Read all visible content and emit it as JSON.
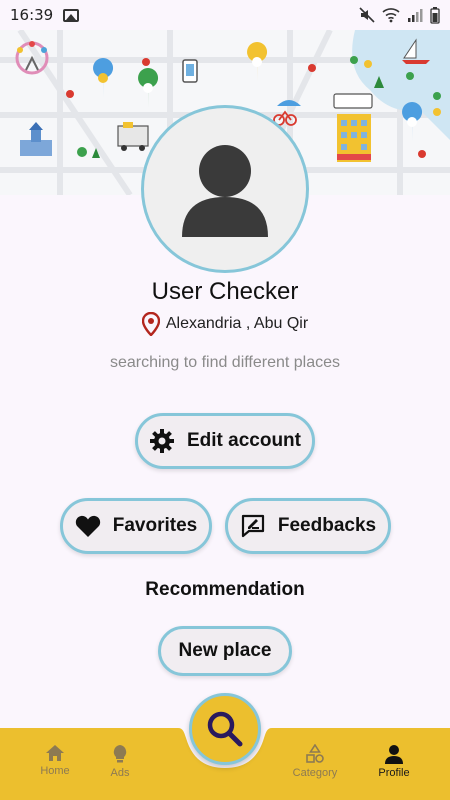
{
  "status_bar": {
    "time": "16:39"
  },
  "profile": {
    "name": "User Checker",
    "location": "Alexandria , Abu Qir",
    "bio": "searching to find different places"
  },
  "actions": {
    "edit_account": "Edit account",
    "favorites": "Favorites",
    "feedbacks": "Feedbacks"
  },
  "recommendation": {
    "title": "Recommendation",
    "new_place": "New place"
  },
  "bottom_nav": {
    "home": "Home",
    "ads": "Ads",
    "category": "Category",
    "profile": "Profile"
  },
  "colors": {
    "accent_yellow": "#ecbf2e",
    "outline_blue": "#86c6d9",
    "pin_red": "#b3261e"
  }
}
